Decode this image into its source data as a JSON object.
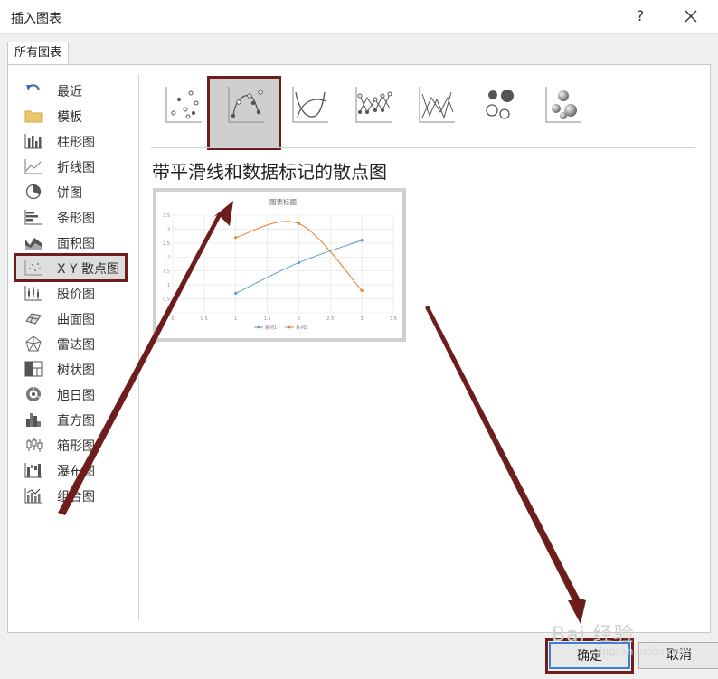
{
  "window": {
    "title": "插入图表",
    "help_label": "?"
  },
  "tabs": [
    {
      "label": "所有图表"
    }
  ],
  "categories": [
    {
      "label": "最近",
      "icon": "undo-arrow-icon"
    },
    {
      "label": "模板",
      "icon": "folder-icon"
    },
    {
      "label": "柱形图",
      "icon": "column-chart-icon"
    },
    {
      "label": "折线图",
      "icon": "line-chart-icon"
    },
    {
      "label": "饼图",
      "icon": "pie-chart-icon"
    },
    {
      "label": "条形图",
      "icon": "bar-chart-icon"
    },
    {
      "label": "面积图",
      "icon": "area-chart-icon"
    },
    {
      "label": "X Y 散点图",
      "icon": "scatter-chart-icon",
      "selected": true
    },
    {
      "label": "股价图",
      "icon": "stock-chart-icon"
    },
    {
      "label": "曲面图",
      "icon": "surface-chart-icon"
    },
    {
      "label": "雷达图",
      "icon": "radar-chart-icon"
    },
    {
      "label": "树状图",
      "icon": "treemap-chart-icon"
    },
    {
      "label": "旭日图",
      "icon": "sunburst-chart-icon"
    },
    {
      "label": "直方图",
      "icon": "histogram-chart-icon"
    },
    {
      "label": "箱形图",
      "icon": "box-whisker-chart-icon"
    },
    {
      "label": "瀑布图",
      "icon": "waterfall-chart-icon"
    },
    {
      "label": "组合图",
      "icon": "combo-chart-icon"
    }
  ],
  "subtypes": [
    {
      "icon": "scatter-markers-icon"
    },
    {
      "icon": "scatter-smooth-lines-markers-icon",
      "selected": true
    },
    {
      "icon": "scatter-smooth-lines-icon"
    },
    {
      "icon": "scatter-straight-lines-markers-icon"
    },
    {
      "icon": "scatter-straight-lines-icon"
    },
    {
      "icon": "bubble-icon"
    },
    {
      "icon": "bubble-3d-icon"
    }
  ],
  "selected_subtype_name": "带平滑线和数据标记的散点图",
  "preview": {
    "chart_data": {
      "type": "scatter",
      "title": "图表标题",
      "xlim": [
        0,
        3.5
      ],
      "ylim": [
        0,
        3.5
      ],
      "x_ticks": [
        "0",
        "0.5",
        "1",
        "1.5",
        "2",
        "2.5",
        "3",
        "3.5"
      ],
      "y_ticks": [
        "0",
        "0.5",
        "1",
        "1.5",
        "2",
        "2.5",
        "3",
        "3.5"
      ],
      "grid": true,
      "legend": "bottom",
      "series": [
        {
          "name": "系列1",
          "color": "#5b9bd5",
          "x": [
            1,
            2,
            3
          ],
          "y": [
            0.7,
            1.8,
            2.6
          ]
        },
        {
          "name": "系列2",
          "color": "#ed7d31",
          "x": [
            1,
            2,
            3
          ],
          "y": [
            2.7,
            3.2,
            0.8
          ]
        }
      ]
    }
  },
  "buttons": {
    "ok": "确定",
    "cancel": "取消"
  },
  "watermark": {
    "text": "Bai 经验",
    "url": "jingyan.baidu.com"
  },
  "annotation_color": "#6e1d1d"
}
